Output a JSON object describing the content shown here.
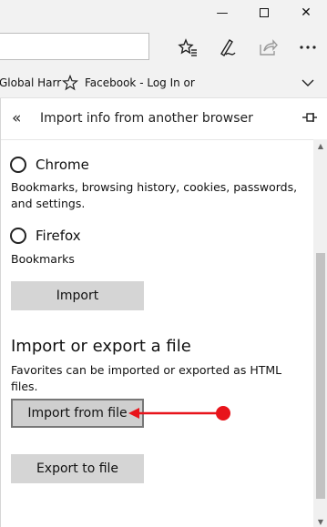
{
  "window": {
    "minimize_glyph": "—",
    "maximize_glyph": "☐",
    "close_glyph": "✕"
  },
  "favorites_bar": {
    "items": [
      {
        "label": "Global Harr"
      },
      {
        "label": "Facebook - Log In or"
      }
    ]
  },
  "pane": {
    "back_glyph": "«",
    "title": "Import info from another browser",
    "browsers": [
      {
        "name": "Chrome",
        "description": "Bookmarks, browsing history, cookies, passwords, and settings."
      },
      {
        "name": "Firefox",
        "description": "Bookmarks"
      }
    ],
    "import_button": "Import",
    "file_section": {
      "title": "Import or export a file",
      "description": "Favorites can be imported or exported as HTML files.",
      "import_from_file_button": "Import from file",
      "export_to_file_button": "Export to file"
    }
  },
  "colors": {
    "annotation_arrow": "#e8141b",
    "button_bg": "#d5d5d5",
    "chrome_bg": "#f2f2f2"
  },
  "icons": [
    "minimize-icon",
    "maximize-icon",
    "close-icon",
    "favorites-star-icon",
    "pen-icon",
    "share-icon",
    "more-icon",
    "star-icon",
    "chevron-down-icon",
    "back-icon",
    "pin-icon"
  ]
}
